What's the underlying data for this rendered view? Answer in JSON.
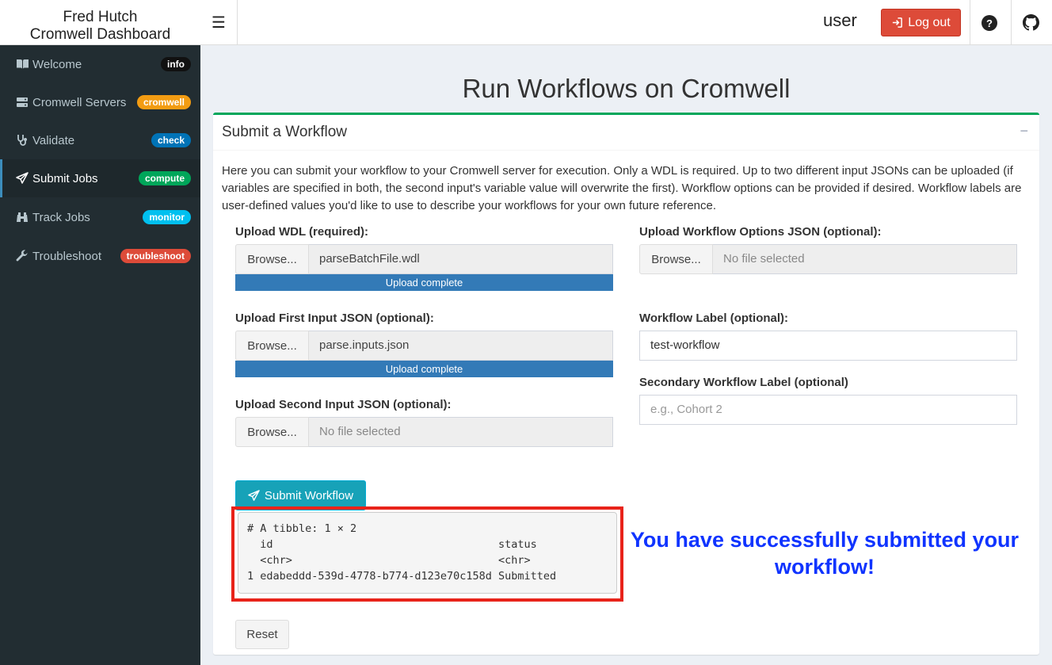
{
  "app": {
    "title_line1": "Fred Hutch",
    "title_line2": "Cromwell Dashboard"
  },
  "header": {
    "user": "user",
    "logout_label": "Log out",
    "help_icon": "question-circle-icon",
    "github_icon": "github-icon"
  },
  "sidebar": {
    "items": [
      {
        "label": "Welcome",
        "badge": "info",
        "badge_color": "#111111",
        "icon": "book-icon"
      },
      {
        "label": "Cromwell Servers",
        "badge": "cromwell",
        "badge_color": "#f39c12",
        "icon": "server-icon"
      },
      {
        "label": "Validate",
        "badge": "check",
        "badge_color": "#0073b7",
        "icon": "stethoscope-icon"
      },
      {
        "label": "Submit Jobs",
        "badge": "compute",
        "badge_color": "#00a65a",
        "icon": "paper-plane-icon",
        "active": true
      },
      {
        "label": "Track Jobs",
        "badge": "monitor",
        "badge_color": "#00c0ef",
        "icon": "binoculars-icon"
      },
      {
        "label": "Troubleshoot",
        "badge": "troubleshoot",
        "badge_color": "#dd4b39",
        "icon": "wrench-icon"
      }
    ]
  },
  "main": {
    "page_title": "Run Workflows on Cromwell",
    "box_title": "Submit a Workflow",
    "collapse_label": "−",
    "description": "Here you can submit your workflow to your Cromwell server for execution. Only a WDL is required. Up to two different input JSONs can be uploaded (if variables are specified in both, the second input's variable value will overwrite the first). Workflow options can be provided if desired. Workflow labels are user-defined values you'd like to use to describe your workflows for your own future reference.",
    "browse_label": "Browse...",
    "upload_wdl": {
      "label": "Upload WDL (required):",
      "file": "parseBatchFile.wdl",
      "progress": "Upload complete"
    },
    "upload_first": {
      "label": "Upload First Input JSON (optional):",
      "file": "parse.inputs.json",
      "progress": "Upload complete"
    },
    "upload_second": {
      "label": "Upload Second Input JSON (optional):",
      "file": "No file selected"
    },
    "upload_options": {
      "label": "Upload Workflow Options JSON (optional):",
      "file": "No file selected"
    },
    "workflow_label": {
      "label": "Workflow Label (optional):",
      "value": "test-workflow"
    },
    "secondary_label": {
      "label": "Secondary Workflow Label (optional)",
      "placeholder": "e.g., Cohort 2"
    },
    "submit_label": "Submit Workflow",
    "output": "# A tibble: 1 × 2\n  id                                   status   \n  <chr>                                <chr>    \n1 edabeddd-539d-4778-b774-d123e70c158d Submitted",
    "success_message": "You have successfully submitted your workflow!",
    "reset_label": "Reset",
    "highlight_color": "#e8231a",
    "accent_color": "#00a65a"
  }
}
